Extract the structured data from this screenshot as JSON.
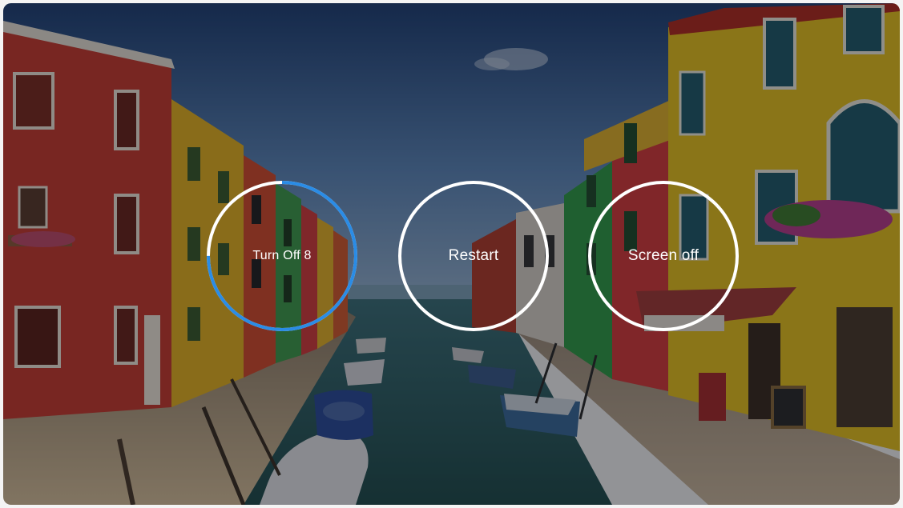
{
  "power_menu": {
    "turn_off": {
      "label": "Turn Off 8",
      "countdown_progress": 0.75,
      "icon": "power-off-icon"
    },
    "restart": {
      "label": "Restart",
      "icon": "restart-icon"
    },
    "screen_off": {
      "label": "Screen off",
      "icon": "screen-off-icon"
    }
  },
  "colors": {
    "ring": "#ffffff",
    "progress": "#2a8ce6",
    "scrim": "rgba(10,12,18,0.42)"
  }
}
